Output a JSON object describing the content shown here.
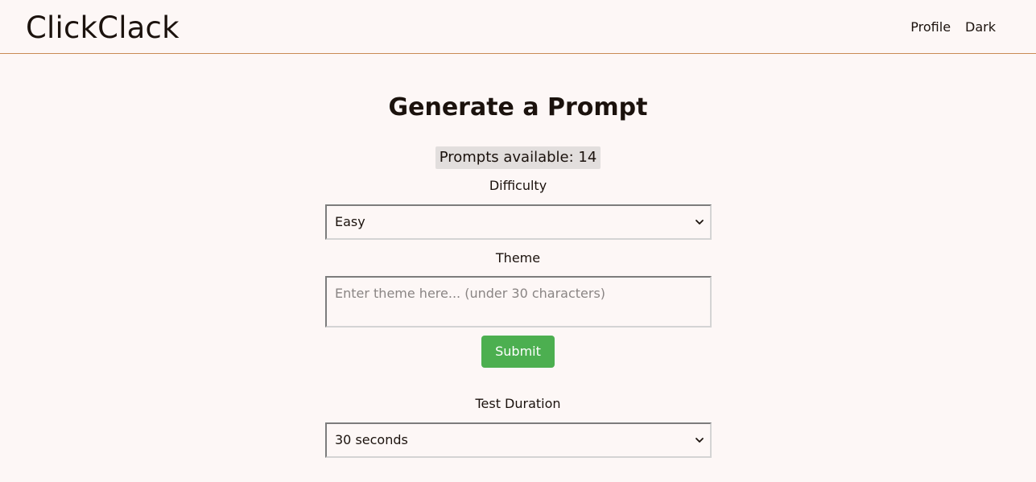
{
  "header": {
    "logo": "ClickClack",
    "nav": {
      "profile": "Profile",
      "theme_toggle": "Dark"
    }
  },
  "main": {
    "title": "Generate a Prompt",
    "prompts_available": "Prompts available: 14",
    "difficulty": {
      "label": "Difficulty",
      "selected": "Easy"
    },
    "theme": {
      "label": "Theme",
      "value": "",
      "placeholder": "Enter theme here... (under 30 characters)"
    },
    "submit_label": "Submit",
    "duration": {
      "label": "Test Duration",
      "selected": "30 seconds"
    }
  },
  "colors": {
    "background": "#fdf7f6",
    "header_border": "#c98a55",
    "submit_button": "#4caf50",
    "badge_background": "#e2dedd"
  },
  "icons": {
    "dropdown": "chevron-down-icon"
  }
}
